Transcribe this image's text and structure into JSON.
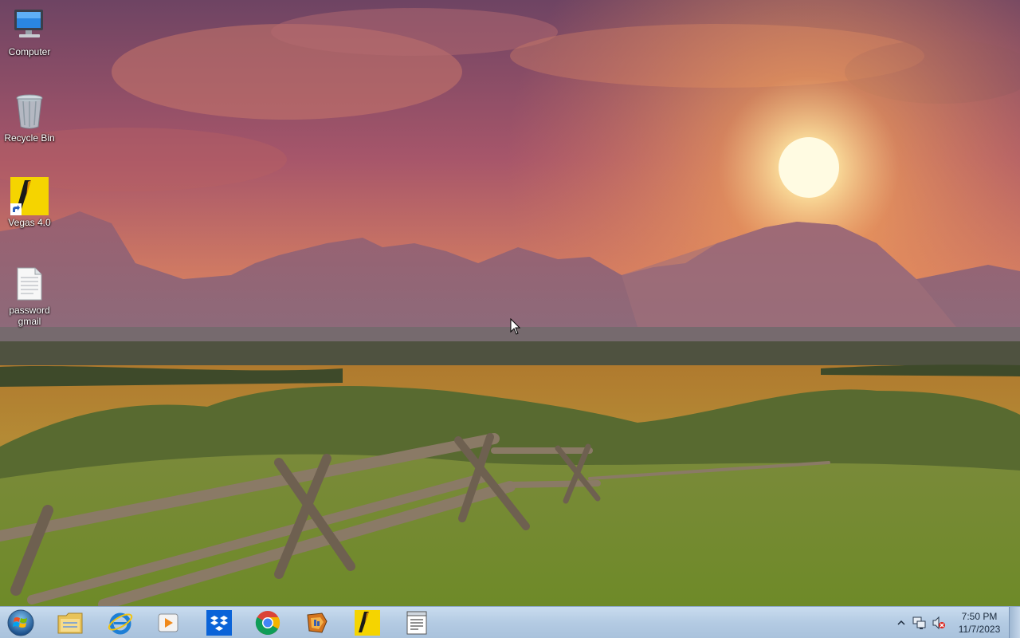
{
  "desktop": {
    "icons": [
      {
        "label": "Computer",
        "icon": "computer-icon"
      },
      {
        "label": "Recycle Bin",
        "icon": "recycle-bin-icon"
      },
      {
        "label": "Vegas 4.0",
        "icon": "vegas-shortcut-icon"
      },
      {
        "label": "password gmail",
        "icon": "text-file-icon"
      }
    ]
  },
  "taskbar": {
    "start_icon": "windows-start-orb-icon",
    "apps": [
      {
        "icon": "file-explorer-icon"
      },
      {
        "icon": "internet-explorer-icon"
      },
      {
        "icon": "media-player-icon"
      },
      {
        "icon": "dropbox-icon"
      },
      {
        "icon": "chrome-icon"
      },
      {
        "icon": "winamp-icon"
      },
      {
        "icon": "vegas-icon"
      },
      {
        "icon": "notepad-document-icon"
      }
    ],
    "tray": {
      "icons": [
        "show-hidden-icons-chevron",
        "network-icon",
        "volume-muted-icon"
      ],
      "time": "7:50 PM",
      "date": "11/7/2023"
    }
  },
  "colors": {
    "taskbar": "#b4cbe3",
    "sky_top": "#7a4a66",
    "sky_glow": "#f39a55",
    "sun": "#fff6c8",
    "grass": "#8a9a30"
  }
}
